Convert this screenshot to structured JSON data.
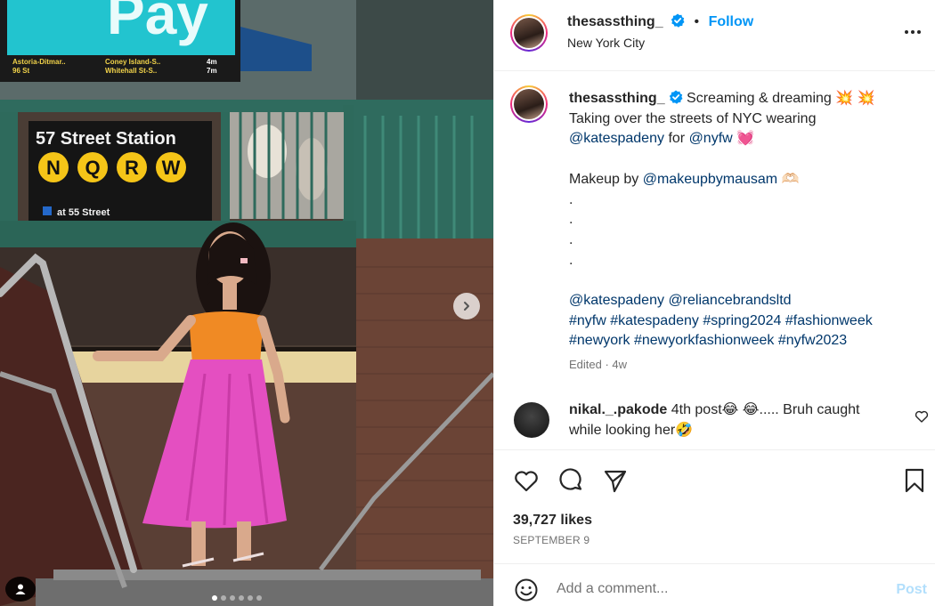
{
  "media": {
    "station_sign": "57 Street Station",
    "train_lines": [
      "N",
      "Q",
      "R",
      "W"
    ],
    "station_sub": "at 55 Street",
    "ad_text": "Pay",
    "ad_small_1": "Astoria-Ditmar..",
    "ad_small_2": "96 St",
    "ad_small_3": "Coney Island-S..",
    "ad_small_4": "Whitehall St-S..",
    "ad_small_5": "4m",
    "ad_small_6": "7m",
    "carousel_index": 1,
    "carousel_total": 6,
    "icons": {
      "next": "chevron-right-icon",
      "tag": "user-tag-icon"
    }
  },
  "header": {
    "username": "thesassthing_",
    "separator": "•",
    "follow_label": "Follow",
    "location": "New York City",
    "icons": {
      "verified": "verified-badge-icon",
      "more": "more-options-icon"
    }
  },
  "caption": {
    "username": "thesassthing_",
    "text_1": "Screaming & dreaming",
    "emoji_1": "💥 💥",
    "line_2": "Taking over the streets of NYC wearing",
    "mention_kate": "@katespadeny",
    "for_word": "for",
    "mention_nyfw": "@nyfw",
    "emoji_heart": "💓",
    "makeup_prefix": "Makeup by",
    "mention_makeup": "@makeupbymausam",
    "emoji_hands": "🫶🏻",
    "dots": [
      ".",
      ".",
      ".",
      "."
    ],
    "mentions_line": [
      "@katespadeny",
      "@reliancebrandsltd"
    ],
    "hashtags_1": [
      "#nyfw",
      "#katespadeny",
      "#spring2024",
      "#fashionweek"
    ],
    "hashtags_2": [
      "#newyork",
      "#newyorkfashionweek",
      "#nyfw2023"
    ],
    "meta": "Edited · 4w"
  },
  "comment": {
    "username": "nikal._.pakode",
    "text_1": "4th post",
    "emoji_1": "😂 😂",
    "text_2": "..... Bruh caught",
    "text_3": "while looking her",
    "emoji_2": "🤣"
  },
  "actions": {
    "likes": "39,727 likes",
    "date": "SEPTEMBER 9",
    "icons": {
      "like": "heart-icon",
      "comment": "comment-icon",
      "share": "share-icon",
      "save": "bookmark-icon"
    }
  },
  "add_comment": {
    "placeholder": "Add a comment...",
    "post_label": "Post",
    "icons": {
      "emoji": "emoji-icon"
    }
  },
  "colors": {
    "accent": "#0095f6",
    "link": "#00376b",
    "post_disabled": "#b2dffc",
    "dress_pink": "#e44fc1",
    "top_orange": "#f08a24"
  }
}
